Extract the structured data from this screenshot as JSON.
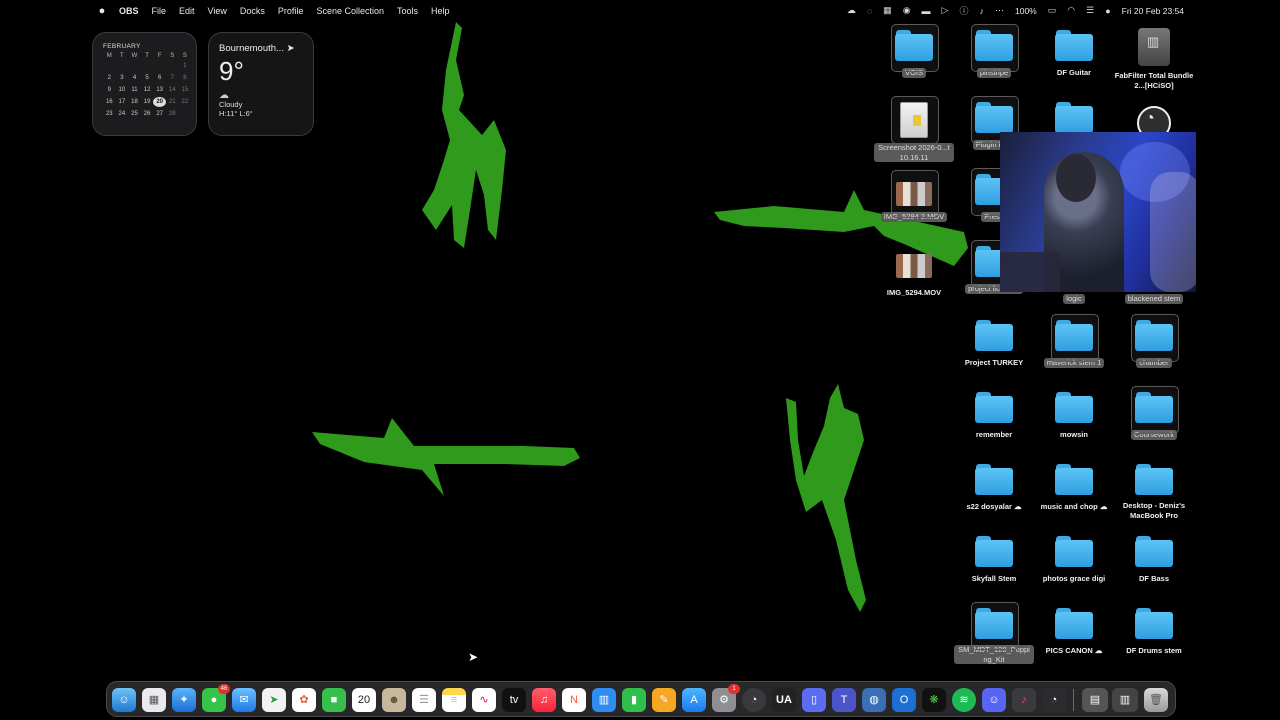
{
  "menubar": {
    "apple_icon": "apple-icon",
    "app_name": "OBS",
    "items": [
      "File",
      "Edit",
      "View",
      "Docks",
      "Profile",
      "Scene Collection",
      "Tools",
      "Help"
    ],
    "battery": "100%",
    "clock": "Fri 20 Feb  23:54"
  },
  "calendar_widget": {
    "month": "FEBRUARY",
    "weekdays": [
      "M",
      "T",
      "W",
      "T",
      "F",
      "S",
      "S"
    ],
    "today": "20"
  },
  "weather_widget": {
    "city": "Bournemouth...",
    "temperature": "9°",
    "condition": "Cloudy",
    "high_low": "H:11° L:6°"
  },
  "desktop_items": {
    "vois": "VOIS",
    "pinstripe": "pinstripe",
    "df_guitar": "DF Guitar",
    "fabfilter": "FabFilter Total Bundle 2...[HCiSO]",
    "screenshot": "Screenshot 2026-0...t 10.16.11",
    "plugin_lice": "Plugin Lice",
    "img_mov_2": "IMG_5294 2.MOV",
    "prese": "Prese",
    "img_mov": "IMG_5294.MOV",
    "project_licenses": "project licenses",
    "logic": "logic",
    "blackened_stem": "blackened stem",
    "project_turkey": "Project TURKEY",
    "maverick_stem": "maverick stem 1",
    "chamber": "chamber",
    "remember": "remember",
    "mowsin": "mowsin",
    "coursework": "Coursework",
    "s22": "s22 dosyalar",
    "music_and_chop": "music and chop",
    "desktop_deniz": "Desktop - Deniz's MacBook Pro",
    "skyfall_stem": "Skyfall Stem",
    "photos_grace": "photos grace digi",
    "df_bass": "DF Bass",
    "sm_mdt": "SM_MDT_128_Popping_Kit",
    "pics_canon": "PICS CANON",
    "df_drums": "DF Drums stem"
  },
  "dock": {
    "calendar_day": "20",
    "messages_badge": "46",
    "settings_badge": "1",
    "tv_label": "tv",
    "ua_label": "UA"
  },
  "colors": {
    "accent_green": "#2f9a1c",
    "folder_blue": "#3fb0ee",
    "badge_red": "#e0312f"
  }
}
